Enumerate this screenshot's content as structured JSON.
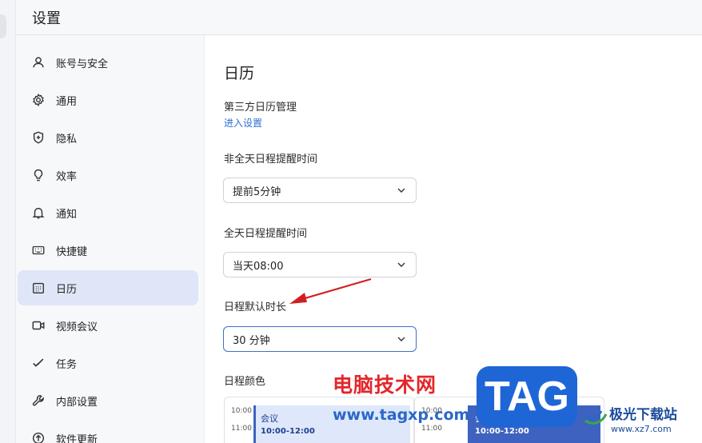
{
  "window": {
    "title": "设置"
  },
  "sidebar": {
    "items": [
      {
        "label": "账号与安全",
        "icon": "user-icon",
        "active": false
      },
      {
        "label": "通用",
        "icon": "gear-icon",
        "active": false
      },
      {
        "label": "隐私",
        "icon": "shield-plus-icon",
        "active": false
      },
      {
        "label": "效率",
        "icon": "lightbulb-icon",
        "active": false
      },
      {
        "label": "通知",
        "icon": "bell-icon",
        "active": false
      },
      {
        "label": "快捷键",
        "icon": "keyboard-icon",
        "active": false
      },
      {
        "label": "日历",
        "icon": "calendar-icon",
        "active": true
      },
      {
        "label": "视频会议",
        "icon": "video-camera-icon",
        "active": false
      },
      {
        "label": "任务",
        "icon": "checkmark-icon",
        "active": false
      },
      {
        "label": "内部设置",
        "icon": "wrench-icon",
        "active": false
      },
      {
        "label": "软件更新",
        "icon": "update-arrow-icon",
        "active": false
      }
    ]
  },
  "main": {
    "title": "日历",
    "third_party": {
      "label": "第三方日历管理",
      "link": "进入设置"
    },
    "non_allday_reminder": {
      "label": "非全天日程提醒时间",
      "value": "提前5分钟"
    },
    "allday_reminder": {
      "label": "全天日程提醒时间",
      "value": "当天08:00"
    },
    "default_duration": {
      "label": "日程默认时长",
      "value": "30 分钟"
    },
    "event_color": {
      "label": "日程颜色",
      "preview_left": {
        "times": [
          "10:00",
          "11:00"
        ],
        "event_title": "会议",
        "event_time": "10:00-12:00"
      },
      "preview_right": {
        "times": [
          "10:00",
          "11:00"
        ],
        "event_title": "会议",
        "event_time": "10:00-12:00"
      }
    }
  },
  "colors": {
    "accent": "#3d62c0",
    "active_nav": "#dfe6f7",
    "link": "#2f6fd6",
    "annotation_arrow": "#d01f24"
  },
  "watermark": {
    "text": "电脑技术网",
    "url": "www.tagxp.com",
    "badge": "TAG",
    "site": "极光下载站",
    "site_url": "www.xz7.com"
  }
}
